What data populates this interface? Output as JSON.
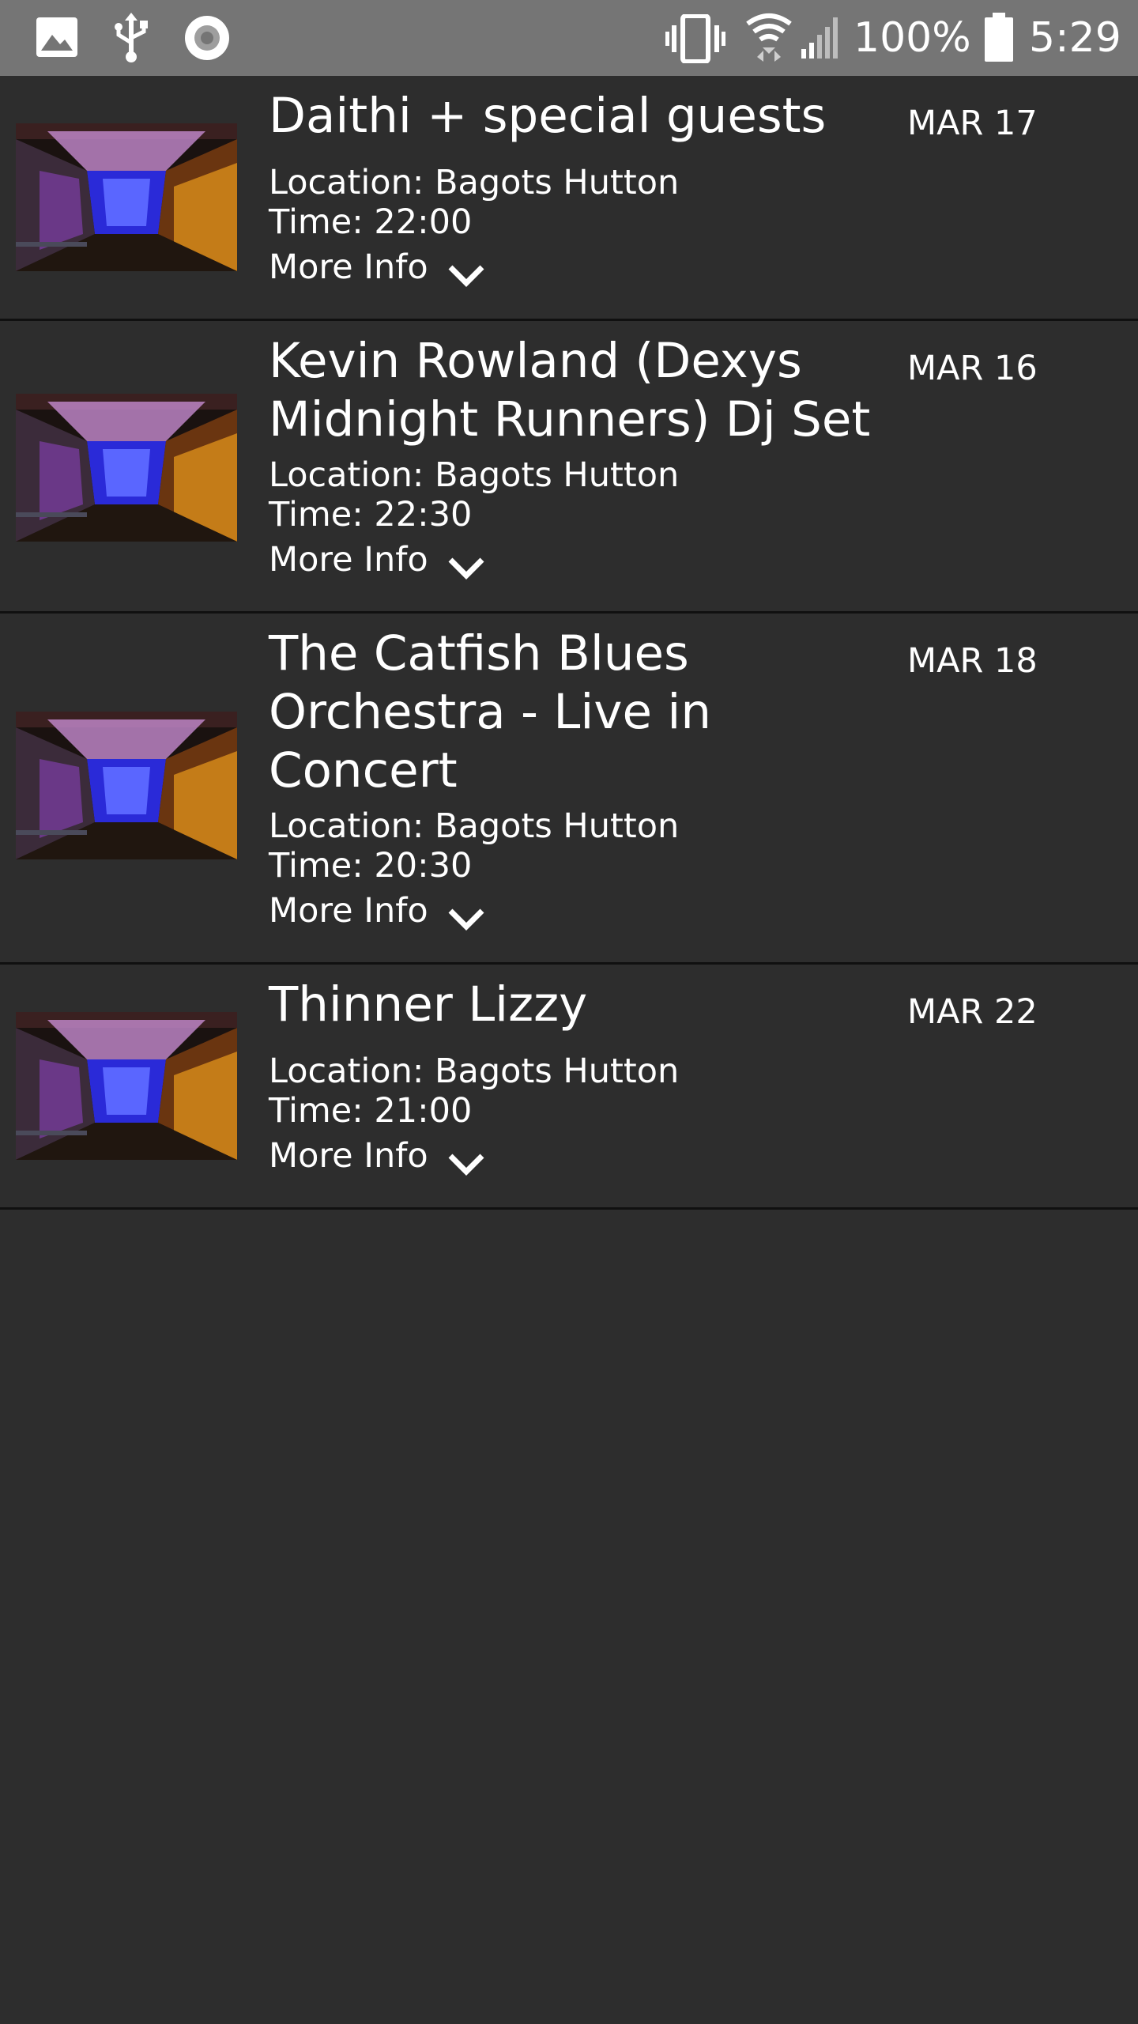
{
  "status_bar": {
    "battery_percent": "100%",
    "time": "5:29",
    "icons": [
      "image-icon",
      "usb-icon",
      "record-icon",
      "vibrate-icon",
      "wifi-icon",
      "cell-signal-icon",
      "battery-icon"
    ]
  },
  "events": [
    {
      "title_lines": [
        "Daithi + special guests"
      ],
      "date": "MAR 17",
      "location": "Location: Bagots Hutton",
      "time": "Time: 22:00",
      "more_info": "More Info"
    },
    {
      "title_lines": [
        "Kevin Rowland (Dexys",
        "Midnight Runners) Dj Set"
      ],
      "date": "MAR 16",
      "location": "Location: Bagots Hutton",
      "time": "Time: 22:30",
      "more_info": "More Info"
    },
    {
      "title_lines": [
        "The Catfish Blues",
        "Orchestra - Live in",
        "Concert"
      ],
      "date": "MAR 18",
      "location": "Location: Bagots Hutton",
      "time": "Time: 20:30",
      "more_info": "More Info"
    },
    {
      "title_lines": [
        "Thinner Lizzy"
      ],
      "date": "MAR 22",
      "location": "Location: Bagots Hutton",
      "time": "Time: 21:00",
      "more_info": "More Info"
    }
  ],
  "colors": {
    "background": "#2d2d2d",
    "status_bar": "#757575",
    "divider": "#101010",
    "text": "#ffffff"
  }
}
